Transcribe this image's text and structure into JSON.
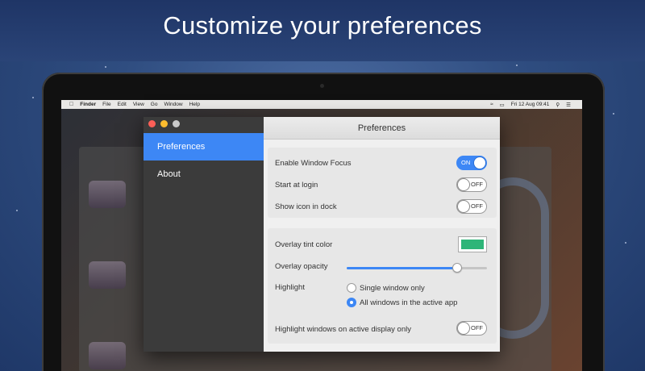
{
  "headline": "Customize your preferences",
  "menubar": {
    "apple_icon": "apple-icon",
    "items": [
      "Finder",
      "File",
      "Edit",
      "View",
      "Go",
      "Window",
      "Help"
    ],
    "clock": "Fri 12 Aug  09:41"
  },
  "window": {
    "title": "Preferences",
    "sidebar": [
      {
        "label": "Preferences",
        "active": true
      },
      {
        "label": "About",
        "active": false
      }
    ]
  },
  "settings": {
    "enable_focus": {
      "label": "Enable Window Focus",
      "state": "ON"
    },
    "start_login": {
      "label": "Start at login",
      "state": "OFF"
    },
    "show_dock": {
      "label": "Show icon in dock",
      "state": "OFF"
    },
    "tint": {
      "label": "Overlay tint color",
      "color": "#2eb578"
    },
    "opacity": {
      "label": "Overlay opacity",
      "value": 0.79
    },
    "highlight": {
      "label": "Highlight",
      "options": [
        {
          "label": "Single window only",
          "selected": false
        },
        {
          "label": "All windows in the active app",
          "selected": true
        }
      ]
    },
    "active_display": {
      "label": "Highlight windows on active display only",
      "state": "OFF"
    }
  },
  "colors": {
    "accent": "#3d87f5",
    "sidebar": "#3b3b3b",
    "tint": "#2eb578"
  }
}
